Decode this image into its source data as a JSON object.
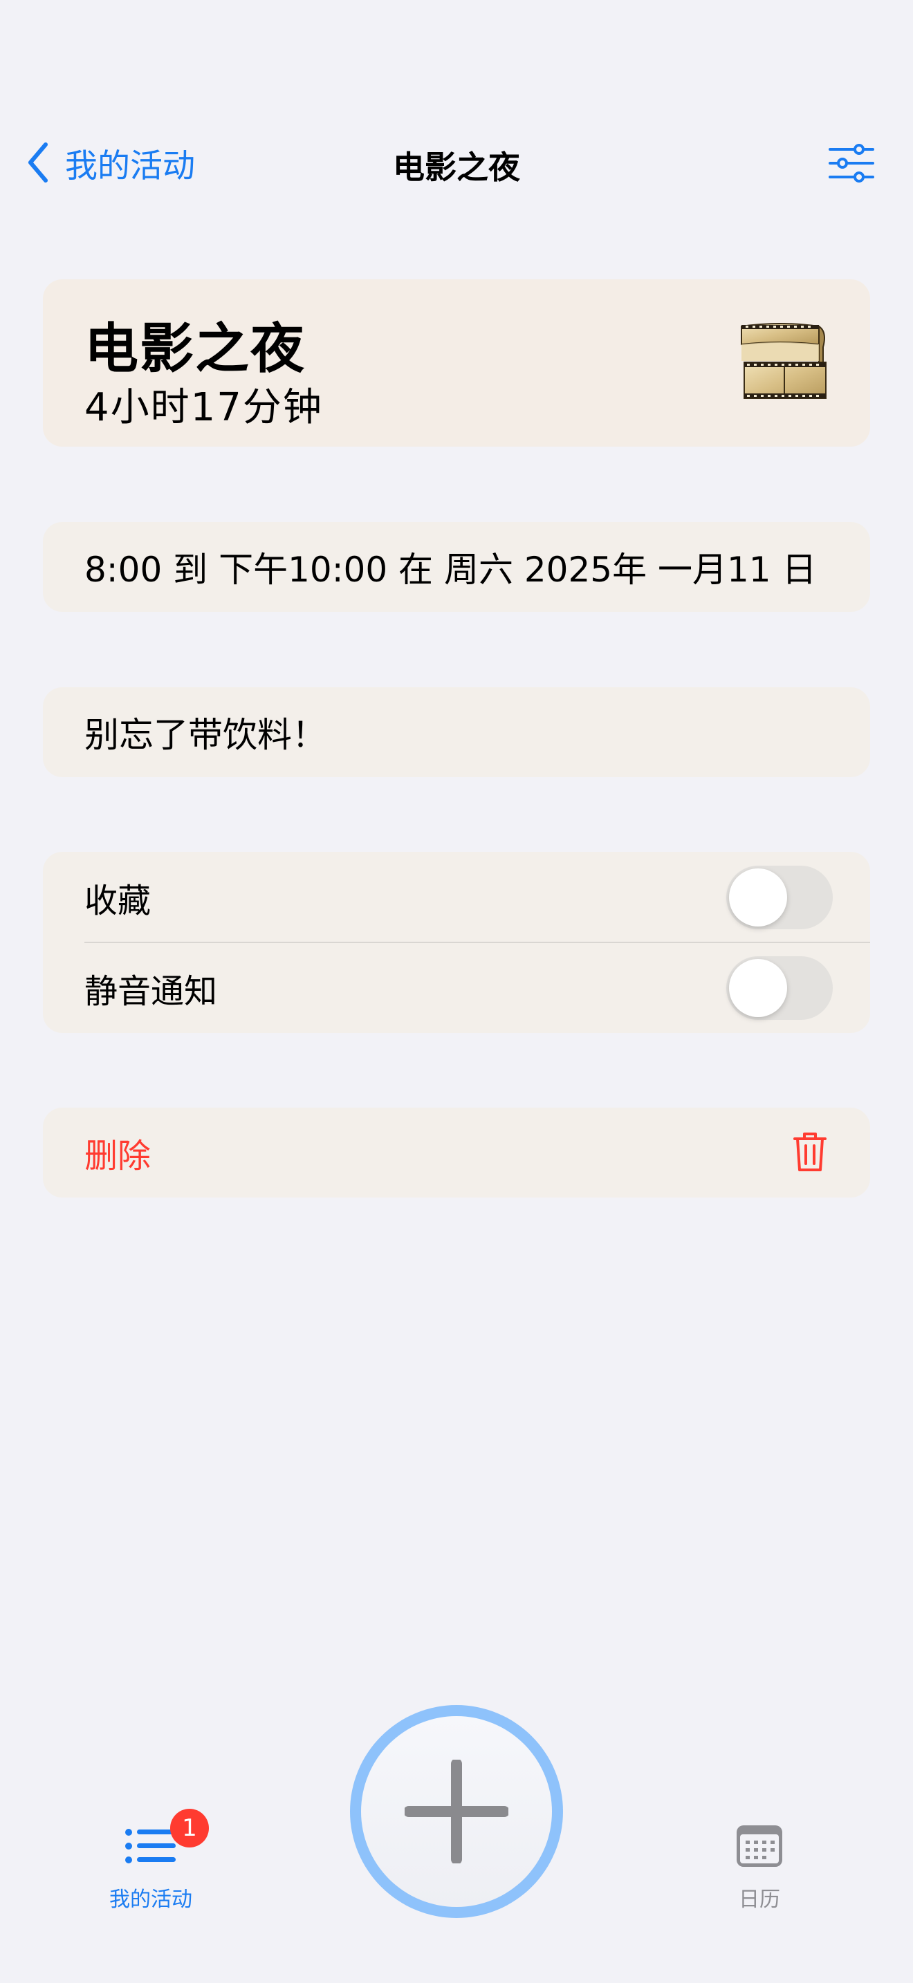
{
  "nav": {
    "back_label": "我的活动",
    "title": "电影之夜"
  },
  "event": {
    "title": "电影之夜",
    "duration": "4小时17分钟",
    "icon": "film-reel-icon"
  },
  "details": {
    "datetime": "8:00 到 下午10:00 在 周六 2025年 一月11 日",
    "note": "别忘了带饮料！"
  },
  "toggles": [
    {
      "label": "收藏",
      "on": false
    },
    {
      "label": "静音通知",
      "on": false
    }
  ],
  "delete": {
    "label": "删除"
  },
  "tabbar": {
    "activities_label": "我的活动",
    "activities_badge": "1",
    "calendar_label": "日历"
  },
  "colors": {
    "accent": "#1a7cf2",
    "destructive": "#ff3b30",
    "card": "#f3efea",
    "background": "#f2f2f7"
  }
}
